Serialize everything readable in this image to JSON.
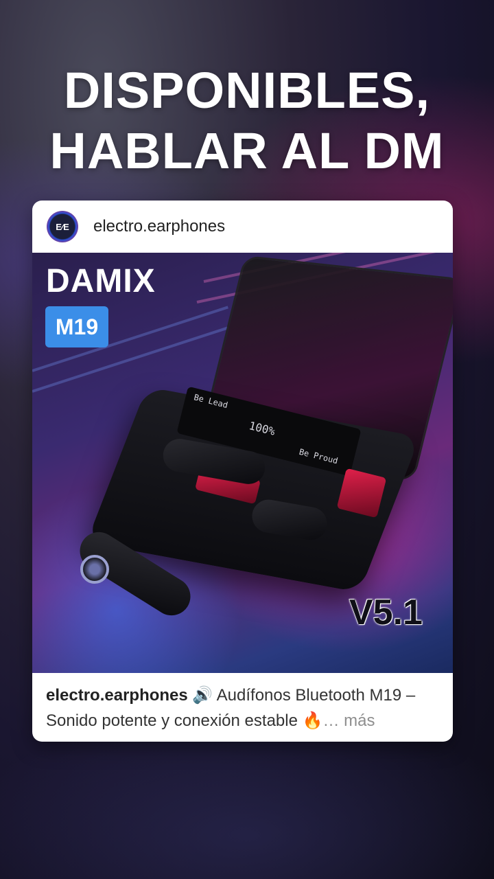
{
  "headline": {
    "line1": "DISPONIBLES,",
    "line2": "HABLAR AL DM"
  },
  "post": {
    "username": "electro.earphones",
    "avatar_text": "E⁄E",
    "image": {
      "brand": "DAMIX",
      "model": "M19",
      "version": "V5.1",
      "display_left": "Be  Lead",
      "display_battery": "100%",
      "display_right": "Be  Proud"
    },
    "caption": {
      "username": "electro.earphones",
      "speaker_icon": "🔊",
      "text1": "Audífonos Bluetooth M19 – Sonido potente y conexión estable",
      "fire_icon": "🔥",
      "more": "… más"
    }
  },
  "colors": {
    "badge": "#3b8ee8",
    "card": "#ffffff",
    "more": "#8e8e8e"
  }
}
